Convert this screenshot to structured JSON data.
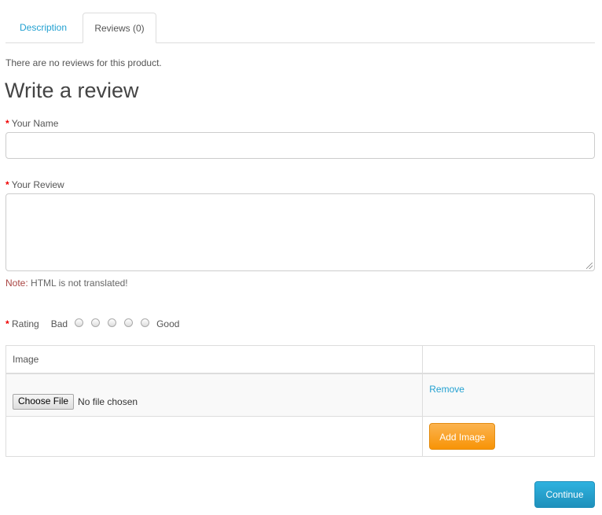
{
  "tabs": {
    "description": "Description",
    "reviews": "Reviews (0)"
  },
  "reviews": {
    "empty_text": "There are no reviews for this product.",
    "heading": "Write a review"
  },
  "form": {
    "required_mark": "*",
    "name_label": "Your Name",
    "name_value": "",
    "review_label": "Your Review",
    "review_value": "",
    "note_label": "Note:",
    "note_text": "HTML is not translated!",
    "rating_label": "Rating",
    "rating_bad": "Bad",
    "rating_good": "Good"
  },
  "image_table": {
    "header": "Image",
    "choose_file": "Choose File",
    "no_file": "No file chosen",
    "remove": "Remove",
    "add_image": "Add Image"
  },
  "actions": {
    "continue": "Continue"
  },
  "colors": {
    "link": "#23a1d1",
    "required": "#f00000",
    "note": "#a94442",
    "add_image_button": "#f89406",
    "continue_button": "#1f90bb"
  }
}
